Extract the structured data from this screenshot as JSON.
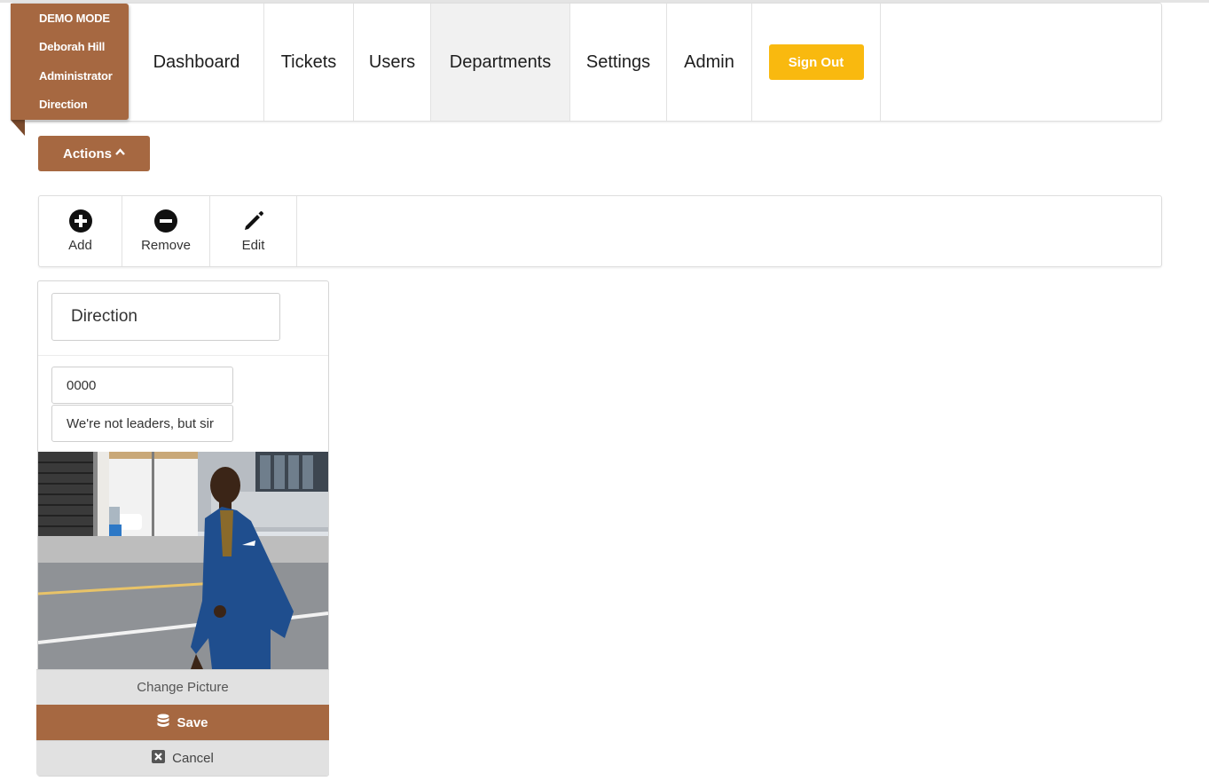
{
  "user_badge": {
    "mode": "DEMO MODE",
    "name": "Deborah Hill",
    "role": "Administrator",
    "department": "Direction"
  },
  "nav": {
    "items": [
      {
        "label": "Dashboard"
      },
      {
        "label": "Tickets"
      },
      {
        "label": "Users"
      },
      {
        "label": "Departments",
        "active": true
      },
      {
        "label": "Settings"
      },
      {
        "label": "Admin"
      }
    ],
    "signout_label": "Sign Out"
  },
  "actions": {
    "label": "Actions"
  },
  "toolbar": {
    "add_label": "Add",
    "remove_label": "Remove",
    "edit_label": "Edit"
  },
  "department_card": {
    "name_value": "Direction",
    "code_value": "0000",
    "description_value": "We're not leaders, but sir",
    "change_picture_label": "Change Picture",
    "save_label": "Save",
    "cancel_label": "Cancel"
  },
  "colors": {
    "brand": "#a66841",
    "signout": "#f9b90f",
    "active_nav_bg": "#f1f1f1",
    "neutral_button": "#e1e1e1"
  },
  "icons": {
    "add": "plus-circle-icon",
    "remove": "minus-circle-icon",
    "edit": "pencil-icon",
    "save": "database-icon",
    "cancel": "close-square-icon",
    "actions_caret": "chevron-up-icon"
  }
}
